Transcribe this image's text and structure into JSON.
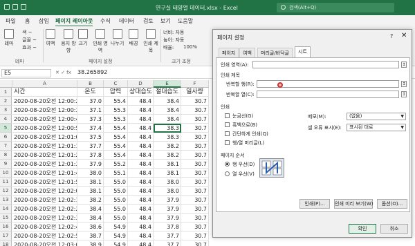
{
  "titlebar": {
    "title": "연구실 태양열 데이터.xlsx  -  Excel",
    "search_placeholder": "검색(Alt+Q)"
  },
  "ribbon_tabs": [
    "파일",
    "홈",
    "삽입",
    "페이지 레이아웃",
    "수식",
    "데이터",
    "검토",
    "보기",
    "도움말"
  ],
  "active_tab": "페이지 레이아웃",
  "ribbon": {
    "theme_label": "테마",
    "colors_label": "색 ~",
    "fonts_label": "글꼴 ~",
    "effects_label": "효과 ~",
    "theme_group": "테마",
    "margins_label": "여백",
    "orientation_label": "용지 방향",
    "size_label": "크기",
    "print_area_label": "인쇄 영역",
    "breaks_label": "나누기",
    "background_label": "배경",
    "print_titles_label": "인쇄 제목",
    "page_setup_group": "페이지 설정",
    "width_label": "너비: 자동",
    "height_label": "높이: 자동",
    "scale_label": "배율:",
    "scale_value": "100%",
    "scale_group": "크기 조정"
  },
  "formula_bar": {
    "name_box": "E5",
    "fx_symbols": "✕  ✓  fx",
    "value": "38.265892"
  },
  "sheet": {
    "columns": [
      "A",
      "B",
      "C",
      "D",
      "E",
      "F"
    ],
    "selected_column": "E",
    "selected_row": 5,
    "header_row": [
      "시간",
      "온도",
      "압력",
      "상대습도",
      "절대습도",
      "일사량"
    ],
    "row_numbers": [
      1,
      2,
      3,
      4,
      5,
      6,
      7,
      8,
      9,
      10,
      11,
      12,
      13,
      14,
      15,
      16,
      17,
      18
    ],
    "rows": [
      [
        "2020-08-20오전 12:00:23",
        "37.0",
        "55.4",
        "48.4",
        "38.4",
        "30.7"
      ],
      [
        "2020-08-20오전 12:00:33",
        "37.1",
        "55.3",
        "48.4",
        "38.4",
        "30.7"
      ],
      [
        "2020-08-20오전 12:00:43",
        "37.3",
        "55.3",
        "48.4",
        "38.4",
        "30.7"
      ],
      [
        "2020-08-20오전 12:00:53",
        "37.4",
        "55.4",
        "48.4",
        "38.3",
        "30.7"
      ],
      [
        "2020-08-20오전 12:01:03",
        "37.5",
        "55.4",
        "48.4",
        "38.3",
        "30.7"
      ],
      [
        "2020-08-20오전 12:01:13",
        "37.7",
        "55.4",
        "48.4",
        "38.2",
        "30.7"
      ],
      [
        "2020-08-20오전 12:01:23",
        "37.8",
        "55.4",
        "48.4",
        "38.2",
        "30.7"
      ],
      [
        "2020-08-20오전 12:01:33",
        "37.9",
        "55.2",
        "48.4",
        "38.1",
        "30.7"
      ],
      [
        "2020-08-20오전 12:01:43",
        "38.0",
        "55.1",
        "48.4",
        "38.1",
        "30.7"
      ],
      [
        "2020-08-20오전 12:01:53",
        "38.1",
        "55.0",
        "48.4",
        "38.0",
        "30.7"
      ],
      [
        "2020-08-20오전 12:02:03",
        "38.1",
        "55.0",
        "48.4",
        "38.0",
        "30.7"
      ],
      [
        "2020-08-20오전 12:02:13",
        "38.2",
        "55.0",
        "48.4",
        "37.9",
        "30.7"
      ],
      [
        "2020-08-20오전 12:02:23",
        "38.4",
        "55.0",
        "48.4",
        "37.9",
        "30.7"
      ],
      [
        "2020-08-20오전 12:02:33",
        "38.4",
        "55.0",
        "48.4",
        "37.9",
        "30.7"
      ],
      [
        "2020-08-20오전 12:02:43",
        "38.6",
        "54.9",
        "48.4",
        "37.8",
        "30.7"
      ],
      [
        "2020-08-20오전 12:02:53",
        "38.7",
        "54.9",
        "48.4",
        "37.7",
        "30.7"
      ],
      [
        "2020-08-20오전 12:03:03",
        "38.9",
        "54.9",
        "48.4",
        "37.7",
        "30.7"
      ]
    ]
  },
  "dialog": {
    "title": "페이지 설정",
    "help": "?",
    "close": "✕",
    "tabs": [
      "페이지",
      "여백",
      "머리글/바닥글",
      "시트"
    ],
    "active_tab": "시트",
    "print_area_label": "인쇄 영역(A):",
    "print_titles_section": "인쇄 제목",
    "rows_repeat_label": "반복할 행(R):",
    "cols_repeat_label": "반복할 열(C):",
    "print_section": "인쇄",
    "gridlines_label": "눈금선(G)",
    "bw_label": "흑백으로(B)",
    "draft_label": "간단하게 인쇄(Q)",
    "headings_label": "행/열 머리글(L)",
    "comments_label": "메모(M):",
    "comments_value": "(없음)",
    "errors_label": "셀 오류 표시(E):",
    "errors_value": "표시된 대로",
    "page_order_section": "페이지 순서",
    "down_then_over": "행 우선(D)",
    "over_then_down": "열 우선(V)",
    "print_button": "인쇄(P)...",
    "preview_button": "인쇄 미리 보기(W)",
    "options_button": "옵션(O)...",
    "ok_button": "확인",
    "cancel_button": "취소",
    "collapse_icon": "↥"
  }
}
